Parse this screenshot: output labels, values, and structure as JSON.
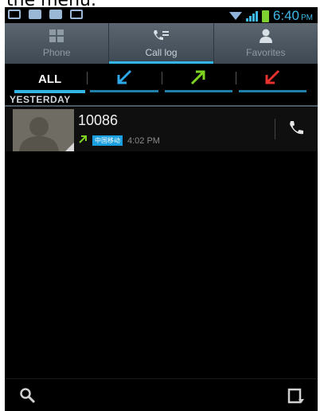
{
  "caption": "the menu.",
  "status_bar": {
    "time": "6:40",
    "ampm": "PM"
  },
  "tabs": [
    {
      "label": "Phone",
      "icon": "dialpad-icon",
      "active": false
    },
    {
      "label": "Call log",
      "icon": "call-log-icon",
      "active": true
    },
    {
      "label": "Favorites",
      "icon": "person-icon",
      "active": false
    }
  ],
  "filters": {
    "all": "ALL",
    "incoming_color": "#2ea8e8",
    "outgoing_color": "#7ed321",
    "missed_color": "#e8322e"
  },
  "section": "YESTERDAY",
  "calls": [
    {
      "number": "10086",
      "carrier": "中国移动",
      "time": "4:02 PM",
      "direction": "outgoing"
    }
  ],
  "colors": {
    "accent": "#33b5e5"
  }
}
